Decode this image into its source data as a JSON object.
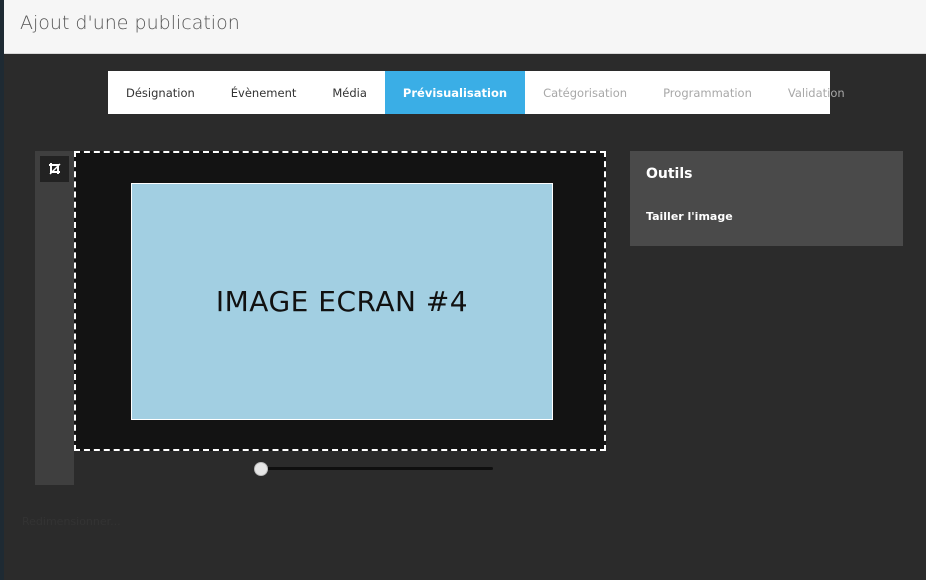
{
  "header": {
    "title": "Ajout d'une publication"
  },
  "tabs": [
    {
      "label": "Désignation",
      "state": "enabled"
    },
    {
      "label": "Évènement",
      "state": "enabled"
    },
    {
      "label": "Média",
      "state": "enabled"
    },
    {
      "label": "Prévisualisation",
      "state": "active"
    },
    {
      "label": "Catégorisation",
      "state": "disabled"
    },
    {
      "label": "Programmation",
      "state": "disabled"
    },
    {
      "label": "Validation",
      "state": "disabled"
    }
  ],
  "toolbar": {
    "crop_icon": "crop-icon"
  },
  "preview": {
    "image_label": "IMAGE ECRAN #4"
  },
  "zoom_slider": {
    "value_fraction": 0.0
  },
  "tools": {
    "title": "Outils",
    "items": [
      "Tailler l'image"
    ]
  },
  "footer": {
    "faint_label": "Redimensionner..."
  },
  "colors": {
    "accent": "#3aaee6",
    "panel_bg": "#2b2b2b",
    "image_bg": "#a2cfe2",
    "tools_bg": "#4a4a4a"
  }
}
